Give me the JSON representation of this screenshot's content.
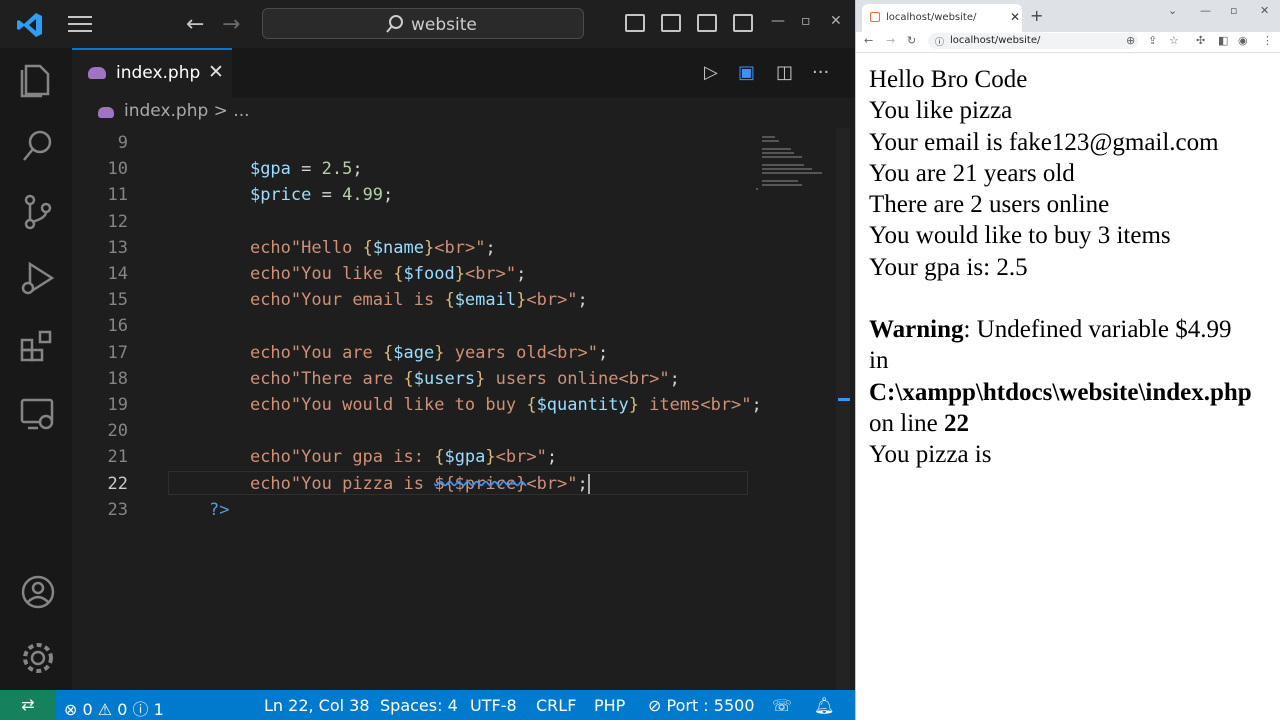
{
  "vscode": {
    "search_text": "website",
    "tab": {
      "filename": "index.php",
      "close": "✕"
    },
    "breadcrumb": "index.php > ...",
    "code_lines": [
      {
        "n": "9",
        "segments": []
      },
      {
        "n": "10",
        "segments": [
          [
            "var",
            "$gpa"
          ],
          [
            "op",
            " = "
          ],
          [
            "num",
            "2.5"
          ],
          [
            "op",
            ";"
          ]
        ]
      },
      {
        "n": "11",
        "segments": [
          [
            "var",
            "$price"
          ],
          [
            "op",
            " = "
          ],
          [
            "num",
            "4.99"
          ],
          [
            "op",
            ";"
          ]
        ]
      },
      {
        "n": "12",
        "segments": []
      },
      {
        "n": "13",
        "segments": [
          [
            "echo",
            "echo"
          ],
          [
            "kw",
            "\"Hello "
          ],
          [
            "brace",
            "{"
          ],
          [
            "var",
            "$name"
          ],
          [
            "brace",
            "}"
          ],
          [
            "kw",
            "<br>\""
          ],
          [
            "op",
            ";"
          ]
        ]
      },
      {
        "n": "14",
        "segments": [
          [
            "echo",
            "echo"
          ],
          [
            "kw",
            "\"You like "
          ],
          [
            "brace",
            "{"
          ],
          [
            "var",
            "$food"
          ],
          [
            "brace",
            "}"
          ],
          [
            "kw",
            "<br>\""
          ],
          [
            "op",
            ";"
          ]
        ]
      },
      {
        "n": "15",
        "segments": [
          [
            "echo",
            "echo"
          ],
          [
            "kw",
            "\"Your email is "
          ],
          [
            "brace",
            "{"
          ],
          [
            "var",
            "$email"
          ],
          [
            "brace",
            "}"
          ],
          [
            "kw",
            "<br>\""
          ],
          [
            "op",
            ";"
          ]
        ]
      },
      {
        "n": "16",
        "segments": []
      },
      {
        "n": "17",
        "segments": [
          [
            "echo",
            "echo"
          ],
          [
            "kw",
            "\"You are "
          ],
          [
            "brace",
            "{"
          ],
          [
            "var",
            "$age"
          ],
          [
            "brace",
            "}"
          ],
          [
            "kw",
            " years old<br>\""
          ],
          [
            "op",
            ";"
          ]
        ]
      },
      {
        "n": "18",
        "segments": [
          [
            "echo",
            "echo"
          ],
          [
            "kw",
            "\"There are "
          ],
          [
            "brace",
            "{"
          ],
          [
            "var",
            "$users"
          ],
          [
            "brace",
            "}"
          ],
          [
            "kw",
            " users online<br>\""
          ],
          [
            "op",
            ";"
          ]
        ]
      },
      {
        "n": "19",
        "segments": [
          [
            "echo",
            "echo"
          ],
          [
            "kw",
            "\"You would like to buy "
          ],
          [
            "brace",
            "{"
          ],
          [
            "var",
            "$quantity"
          ],
          [
            "brace",
            "}"
          ],
          [
            "kw",
            " items<br>\""
          ],
          [
            "op",
            ";"
          ]
        ]
      },
      {
        "n": "20",
        "segments": []
      },
      {
        "n": "21",
        "segments": [
          [
            "echo",
            "echo"
          ],
          [
            "kw",
            "\"Your gpa is: "
          ],
          [
            "brace",
            "{"
          ],
          [
            "var",
            "$gpa"
          ],
          [
            "brace",
            "}"
          ],
          [
            "kw",
            "<br>\""
          ],
          [
            "op",
            ";"
          ]
        ]
      },
      {
        "n": "22",
        "segments": [
          [
            "echo",
            "echo"
          ],
          [
            "kw",
            "\"You pizza is "
          ],
          [
            "strike",
            "${$price}"
          ],
          [
            "kw",
            "<br>\""
          ],
          [
            "op",
            ";"
          ]
        ]
      },
      {
        "n": "23",
        "segments": [
          [
            "tag",
            "?>"
          ]
        ]
      }
    ],
    "status": {
      "errors": "0",
      "warnings": "0",
      "info": "1",
      "position": "Ln 22, Col 38",
      "spaces": "Spaces: 4",
      "encoding": "UTF-8",
      "eol": "CRLF",
      "language": "PHP",
      "port": "Port : 5500"
    }
  },
  "browser": {
    "tab_title": "localhost/website/",
    "url": "localhost/website/",
    "output": {
      "l1": "Hello Bro Code",
      "l2": "You like pizza",
      "l3": "Your email is fake123@gmail.com",
      "l4": "You are 21 years old",
      "l5": "There are 2 users online",
      "l6": "You would like to buy 3 items",
      "l7": "Your gpa is: 2.5",
      "warning_label": "Warning",
      "warning_text": ": Undefined variable $4.99",
      "in": "in",
      "path": "C:\\xampp\\htdocs\\website\\index.php",
      "on_line": "on line ",
      "line_no": "22",
      "last": "You pizza is"
    }
  }
}
